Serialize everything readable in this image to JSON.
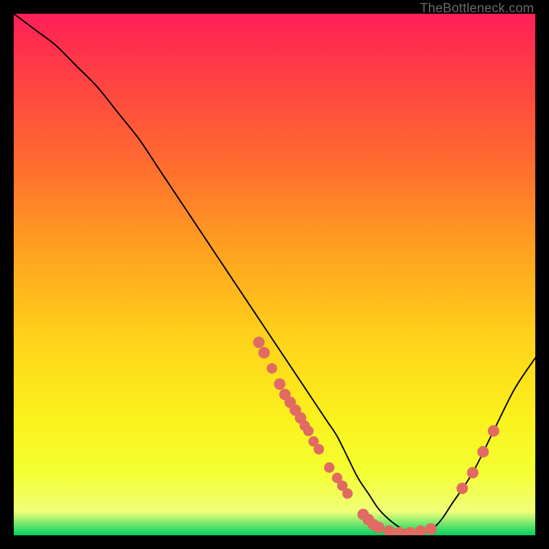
{
  "attribution": "TheBottleneck.com",
  "chart_data": {
    "type": "line",
    "title": "",
    "xlabel": "",
    "ylabel": "",
    "xlim": [
      0,
      100
    ],
    "ylim": [
      0,
      100
    ],
    "gradient_colors_top_to_bottom": [
      "#ff1f58",
      "#ff4044",
      "#ff6a2f",
      "#ffa020",
      "#ffd21a",
      "#faf21c",
      "#f4ff33",
      "#efff7a",
      "#00d060"
    ],
    "series": [
      {
        "name": "bottleneck-curve",
        "x": [
          0,
          4,
          8,
          12,
          16,
          20,
          24,
          28,
          32,
          36,
          40,
          44,
          48,
          52,
          56,
          60,
          62,
          64,
          66,
          68,
          70,
          72,
          74,
          76,
          78,
          80,
          82,
          84,
          88,
          92,
          96,
          100
        ],
        "y": [
          100,
          97,
          94,
          90,
          86,
          81,
          76,
          70,
          64,
          58,
          52,
          46,
          40,
          34,
          28,
          22,
          19,
          15,
          11,
          8,
          5,
          3,
          1.5,
          0.5,
          0.5,
          1,
          3,
          6,
          12,
          20,
          28,
          34
        ],
        "stroke": "#000000",
        "stroke_width": 2
      }
    ],
    "markers": [
      {
        "x": 47,
        "y": 37,
        "r": 1.1
      },
      {
        "x": 48,
        "y": 35,
        "r": 1.1
      },
      {
        "x": 49.5,
        "y": 32,
        "r": 1.0
      },
      {
        "x": 51,
        "y": 29,
        "r": 1.1
      },
      {
        "x": 52,
        "y": 27,
        "r": 1.1
      },
      {
        "x": 53,
        "y": 25.5,
        "r": 1.1
      },
      {
        "x": 54,
        "y": 24,
        "r": 1.1
      },
      {
        "x": 55,
        "y": 22.5,
        "r": 1.1
      },
      {
        "x": 55.8,
        "y": 21,
        "r": 1.0
      },
      {
        "x": 56.5,
        "y": 20,
        "r": 1.0
      },
      {
        "x": 57.5,
        "y": 18,
        "r": 1.0
      },
      {
        "x": 58.5,
        "y": 16.5,
        "r": 1.0
      },
      {
        "x": 60.5,
        "y": 13,
        "r": 1.0
      },
      {
        "x": 62,
        "y": 11,
        "r": 1.0
      },
      {
        "x": 63,
        "y": 9.5,
        "r": 1.0
      },
      {
        "x": 64,
        "y": 8,
        "r": 1.0
      },
      {
        "x": 67,
        "y": 4,
        "r": 1.1
      },
      {
        "x": 68,
        "y": 3,
        "r": 1.1
      },
      {
        "x": 69,
        "y": 2,
        "r": 1.1
      },
      {
        "x": 70,
        "y": 1.5,
        "r": 1.1
      },
      {
        "x": 72,
        "y": 0.8,
        "r": 1.1
      },
      {
        "x": 74,
        "y": 0.5,
        "r": 1.1
      },
      {
        "x": 76,
        "y": 0.5,
        "r": 1.1
      },
      {
        "x": 78,
        "y": 0.8,
        "r": 1.1
      },
      {
        "x": 80,
        "y": 1.2,
        "r": 1.1
      },
      {
        "x": 86,
        "y": 9,
        "r": 1.1
      },
      {
        "x": 88,
        "y": 12,
        "r": 1.1
      },
      {
        "x": 90,
        "y": 16,
        "r": 1.1
      },
      {
        "x": 92,
        "y": 20,
        "r": 1.1
      }
    ],
    "marker_color": "#e16a62"
  }
}
